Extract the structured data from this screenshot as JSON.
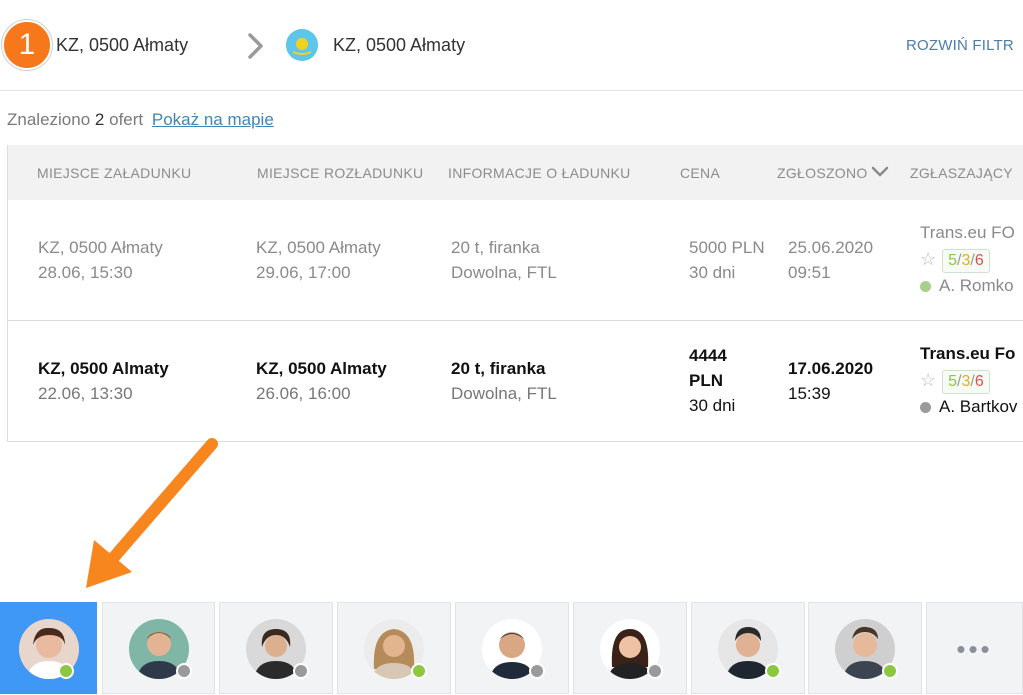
{
  "header": {
    "step": "1",
    "from": "KZ, 0500 Ałmaty",
    "to": "KZ, 0500 Ałmaty",
    "expand_filters": "ROZWIŃ FILTR"
  },
  "results": {
    "prefix": "Znaleziono",
    "count": "2",
    "suffix": "ofert",
    "map_link": "Pokaż na mapie"
  },
  "table": {
    "columns": [
      "MIEJSCE ZAŁADUNKU",
      "MIEJSCE ROZŁADUNKU",
      "INFORMACJE O ŁADUNKU",
      "CENA",
      "ZGŁOSZONO",
      "ZGŁASZAJĄCY"
    ],
    "rows": [
      {
        "loading_place": "KZ, 0500 Ałmaty",
        "loading_date": "28.06, 15:30",
        "unloading_place": "KZ, 0500 Ałmaty",
        "unloading_date": "29.06, 17:00",
        "cargo": "20 t, firanka",
        "cargo_type": "Dowolna, FTL",
        "price": "5000 PLN",
        "terms": "30 dni",
        "reported_date": "25.06.2020",
        "reported_time": "09:51",
        "company": "Trans.eu FO",
        "rating": [
          "5",
          "3",
          "6"
        ],
        "person": "A. Romko",
        "person_status_color": "#a8d08d"
      },
      {
        "loading_place": "KZ, 0500 Almaty",
        "loading_date": "22.06, 13:30",
        "unloading_place": "KZ, 0500 Almaty",
        "unloading_date": "26.06, 16:00",
        "cargo": "20 t, firanka",
        "cargo_type": "Dowolna, FTL",
        "price_line1": "4444",
        "price_line2": "PLN",
        "terms": "30 dni",
        "reported_date": "17.06.2020",
        "reported_time": "15:39",
        "company": "Trans.eu Fo",
        "rating": [
          "5",
          "3",
          "6"
        ],
        "person": "A. Bartkov",
        "person_status_color": "#9a9a9a"
      }
    ]
  },
  "bottom_bar": {
    "contacts": [
      {
        "status": "online",
        "active": true
      },
      {
        "status": "away",
        "active": false
      },
      {
        "status": "away",
        "active": false
      },
      {
        "status": "online",
        "active": false
      },
      {
        "status": "away",
        "active": false
      },
      {
        "status": "away",
        "active": false
      },
      {
        "status": "online",
        "active": false
      },
      {
        "status": "online",
        "active": false
      }
    ],
    "more_label": "•••"
  },
  "colors": {
    "accent_orange": "#f7781a",
    "active_tile": "#3f97f6",
    "link": "#3f86b6",
    "online": "#8dc63f",
    "away": "#9a9a9a"
  }
}
